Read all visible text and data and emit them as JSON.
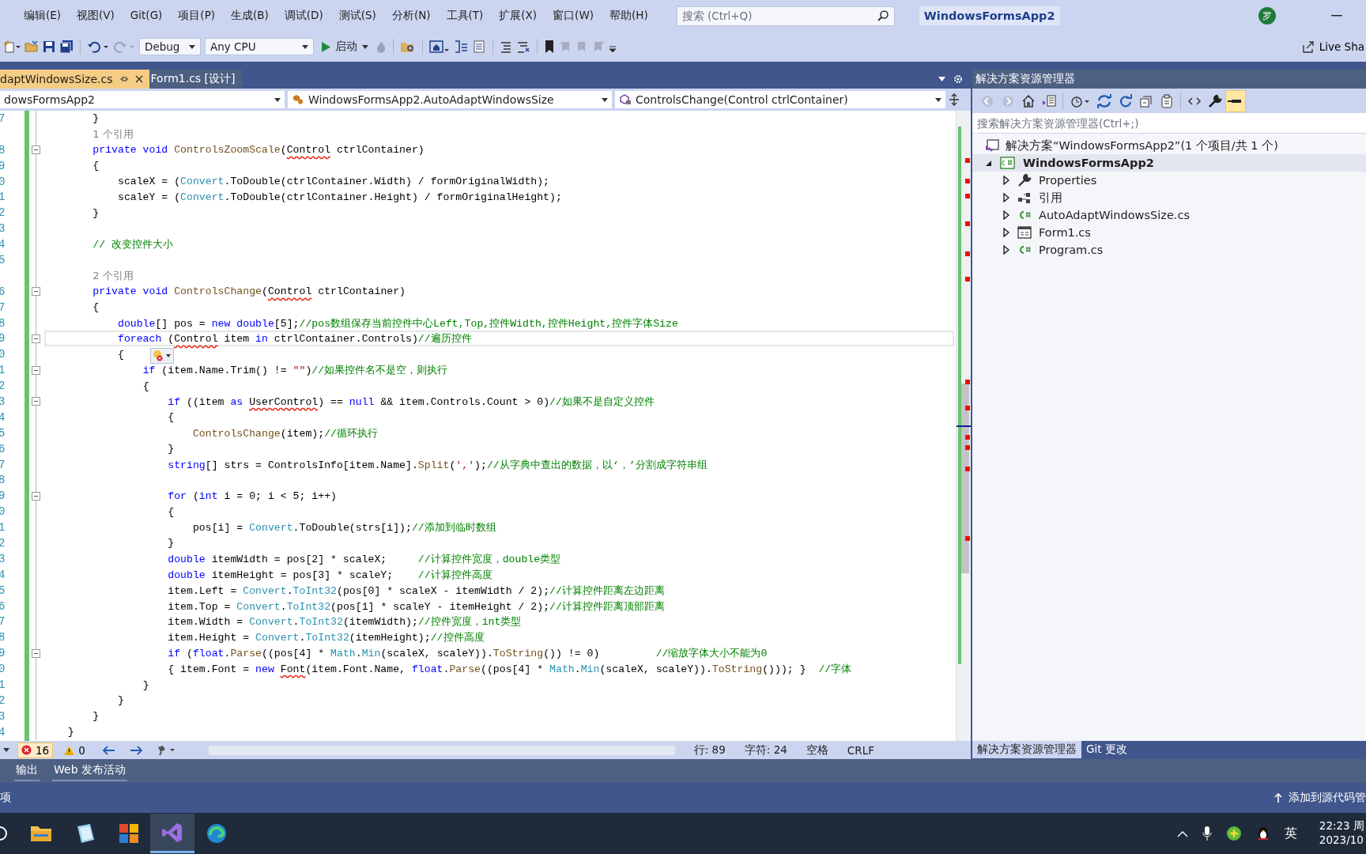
{
  "menu": [
    "编辑(E)",
    "视图(V)",
    "Git(G)",
    "项目(P)",
    "生成(B)",
    "调试(D)",
    "测试(S)",
    "分析(N)",
    "工具(T)",
    "扩展(X)",
    "窗口(W)",
    "帮助(H)"
  ],
  "search": {
    "placeholder": "搜索 (Ctrl+Q)"
  },
  "title": "WindowsFormsApp2",
  "account": {
    "initial": "罗"
  },
  "toolbar": {
    "configuration": "Debug",
    "platform": "Any CPU",
    "start": "启动",
    "live_share": "Live Sha"
  },
  "tabs": [
    {
      "label": "daptWindowsSize.cs",
      "selected": true
    },
    {
      "label": "Form1.cs [设计]",
      "selected": false
    }
  ],
  "nav": [
    "dowsFormsApp2",
    "WindowsFormsApp2.AutoAdaptWindowsSize",
    "ControlsChange(Control ctrlContainer)"
  ],
  "code": [
    {
      "kind": "code",
      "n": "7",
      "fold": false,
      "current": false,
      "tokens": [
        {
          "kind": "plain",
          "text": "        }"
        }
      ]
    },
    {
      "kind": "lens",
      "text": "        1 个引用"
    },
    {
      "kind": "code",
      "n": "8",
      "fold": true,
      "current": false,
      "tokens": [
        {
          "kind": "keyword",
          "text": "        private void"
        },
        {
          "kind": "method",
          "text": " ControlsZoomScale"
        },
        {
          "kind": "plain",
          "text": "("
        },
        {
          "kind": "error",
          "text": "Control"
        },
        {
          "kind": "plain",
          "text": " ctrlContainer)"
        }
      ]
    },
    {
      "kind": "code",
      "n": "9",
      "fold": false,
      "current": false,
      "tokens": [
        {
          "kind": "plain",
          "text": "        {"
        }
      ]
    },
    {
      "kind": "code",
      "n": "0",
      "fold": false,
      "current": false,
      "tokens": [
        {
          "kind": "plain",
          "text": "            scaleX = ("
        },
        {
          "kind": "type",
          "text": "Convert"
        },
        {
          "kind": "plain",
          "text": ".ToDouble(ctrlContainer.Width) / formOriginalWidth);"
        }
      ]
    },
    {
      "kind": "code",
      "n": "1",
      "fold": false,
      "current": false,
      "tokens": [
        {
          "kind": "plain",
          "text": "            scaleY = ("
        },
        {
          "kind": "type",
          "text": "Convert"
        },
        {
          "kind": "plain",
          "text": ".ToDouble(ctrlContainer.Height) / formOriginalHeight);"
        }
      ]
    },
    {
      "kind": "code",
      "n": "2",
      "fold": false,
      "current": false,
      "tokens": [
        {
          "kind": "plain",
          "text": "        }"
        }
      ]
    },
    {
      "kind": "code",
      "n": "3",
      "fold": false,
      "current": false
    },
    {
      "kind": "code",
      "n": "4",
      "fold": false,
      "current": false,
      "tokens": [
        {
          "kind": "comment",
          "text": "        // 改变控件大小"
        }
      ]
    },
    {
      "kind": "code",
      "n": "5",
      "fold": false,
      "current": false
    },
    {
      "kind": "lens",
      "text": "        2 个引用"
    },
    {
      "kind": "code",
      "n": "6",
      "fold": true,
      "current": false,
      "tokens": [
        {
          "kind": "keyword",
          "text": "        private void"
        },
        {
          "kind": "method",
          "text": " ControlsChange"
        },
        {
          "kind": "plain",
          "text": "("
        },
        {
          "kind": "error",
          "text": "Control"
        },
        {
          "kind": "plain",
          "text": " ctrlContainer)"
        }
      ]
    },
    {
      "kind": "code",
      "n": "7",
      "fold": false,
      "current": false,
      "tokens": [
        {
          "kind": "plain",
          "text": "        {"
        }
      ]
    },
    {
      "kind": "code",
      "n": "8",
      "fold": false,
      "current": false,
      "tokens": [
        {
          "kind": "keyword",
          "text": "            double"
        },
        {
          "kind": "plain",
          "text": "[] pos = "
        },
        {
          "kind": "keyword",
          "text": "new double"
        },
        {
          "kind": "plain",
          "text": "[5];"
        },
        {
          "kind": "comment",
          "text": "//pos数组保存当前控件中心Left,Top,控件Width,控件Height,控件字体Size"
        }
      ]
    },
    {
      "kind": "code",
      "n": "9",
      "fold": true,
      "current": true,
      "tokens": [
        {
          "kind": "keyword",
          "text": "            foreach"
        },
        {
          "kind": "plain",
          "text": " ("
        },
        {
          "kind": "error",
          "text": "Control"
        },
        {
          "kind": "plain",
          "text": " item "
        },
        {
          "kind": "keyword",
          "text": "in"
        },
        {
          "kind": "plain",
          "text": " ctrlContainer.Controls)"
        },
        {
          "kind": "comment",
          "text": "//遍历控件"
        }
      ]
    },
    {
      "kind": "code",
      "n": "0",
      "fold": false,
      "current": false,
      "tokens": [
        {
          "kind": "plain",
          "text": "            {"
        }
      ]
    },
    {
      "kind": "code",
      "n": "1",
      "fold": true,
      "current": false,
      "tokens": [
        {
          "kind": "keyword",
          "text": "                if"
        },
        {
          "kind": "plain",
          "text": " (item.Name.Trim() != "
        },
        {
          "kind": "string",
          "text": "\"\""
        },
        {
          "kind": "plain",
          "text": ")"
        },
        {
          "kind": "comment",
          "text": "//如果控件名不是空，则执行"
        }
      ]
    },
    {
      "kind": "code",
      "n": "2",
      "fold": false,
      "current": false,
      "tokens": [
        {
          "kind": "plain",
          "text": "                {"
        }
      ]
    },
    {
      "kind": "code",
      "n": "3",
      "fold": true,
      "current": false,
      "tokens": [
        {
          "kind": "keyword",
          "text": "                    if"
        },
        {
          "kind": "plain",
          "text": " ((item "
        },
        {
          "kind": "keyword",
          "text": "as "
        },
        {
          "kind": "error",
          "text": "UserControl"
        },
        {
          "kind": "plain",
          "text": ") == "
        },
        {
          "kind": "keyword",
          "text": "null"
        },
        {
          "kind": "plain",
          "text": " && item.Controls.Count > 0)"
        },
        {
          "kind": "comment",
          "text": "//如果不是自定义控件"
        }
      ]
    },
    {
      "kind": "code",
      "n": "4",
      "fold": false,
      "current": false,
      "tokens": [
        {
          "kind": "plain",
          "text": "                    {"
        }
      ]
    },
    {
      "kind": "code",
      "n": "5",
      "fold": false,
      "current": false,
      "tokens": [
        {
          "kind": "method",
          "text": "                        ControlsChange"
        },
        {
          "kind": "plain",
          "text": "(item);"
        },
        {
          "kind": "comment",
          "text": "//循环执行"
        }
      ]
    },
    {
      "kind": "code",
      "n": "6",
      "fold": false,
      "current": false,
      "tokens": [
        {
          "kind": "plain",
          "text": "                    }"
        }
      ]
    },
    {
      "kind": "code",
      "n": "7",
      "fold": false,
      "current": false,
      "tokens": [
        {
          "kind": "keyword",
          "text": "                    string"
        },
        {
          "kind": "plain",
          "text": "[] strs = ControlsInfo[item.Name]."
        },
        {
          "kind": "method",
          "text": "Split"
        },
        {
          "kind": "plain",
          "text": "("
        },
        {
          "kind": "string",
          "text": "','"
        },
        {
          "kind": "plain",
          "text": ");"
        },
        {
          "kind": "comment",
          "text": "//从字典中查出的数据，以‘，’分割成字符串组"
        }
      ]
    },
    {
      "kind": "code",
      "n": "8",
      "fold": false,
      "current": false
    },
    {
      "kind": "code",
      "n": "9",
      "fold": true,
      "current": false,
      "tokens": [
        {
          "kind": "keyword",
          "text": "                    for"
        },
        {
          "kind": "plain",
          "text": " ("
        },
        {
          "kind": "keyword",
          "text": "int"
        },
        {
          "kind": "plain",
          "text": " i = 0; i < 5; i++)"
        }
      ]
    },
    {
      "kind": "code",
      "n": "0",
      "fold": false,
      "current": false,
      "tokens": [
        {
          "kind": "plain",
          "text": "                    {"
        }
      ]
    },
    {
      "kind": "code",
      "n": "1",
      "fold": false,
      "current": false,
      "tokens": [
        {
          "kind": "plain",
          "text": "                        pos[i] = "
        },
        {
          "kind": "type",
          "text": "Convert"
        },
        {
          "kind": "plain",
          "text": ".ToDouble(strs[i]);"
        },
        {
          "kind": "comment",
          "text": "//添加到临时数组"
        }
      ]
    },
    {
      "kind": "code",
      "n": "2",
      "fold": false,
      "current": false,
      "tokens": [
        {
          "kind": "plain",
          "text": "                    }"
        }
      ]
    },
    {
      "kind": "code",
      "n": "3",
      "fold": false,
      "current": false,
      "tokens": [
        {
          "kind": "keyword",
          "text": "                    double"
        },
        {
          "kind": "plain",
          "text": " itemWidth = pos[2] * scaleX;     "
        },
        {
          "kind": "comment",
          "text": "//计算控件宽度，double类型"
        }
      ]
    },
    {
      "kind": "code",
      "n": "4",
      "fold": false,
      "current": false,
      "tokens": [
        {
          "kind": "keyword",
          "text": "                    double"
        },
        {
          "kind": "plain",
          "text": " itemHeight = pos[3] * scaleY;    "
        },
        {
          "kind": "comment",
          "text": "//计算控件高度"
        }
      ]
    },
    {
      "kind": "code",
      "n": "5",
      "fold": false,
      "current": false,
      "tokens": [
        {
          "kind": "plain",
          "text": "                    item.Left = "
        },
        {
          "kind": "type",
          "text": "Convert"
        },
        {
          "kind": "plain",
          "text": "."
        },
        {
          "kind": "type",
          "text": "ToInt32"
        },
        {
          "kind": "plain",
          "text": "(pos[0] * scaleX - itemWidth / 2);"
        },
        {
          "kind": "comment",
          "text": "//计算控件距离左边距离"
        }
      ]
    },
    {
      "kind": "code",
      "n": "6",
      "fold": false,
      "current": false,
      "tokens": [
        {
          "kind": "plain",
          "text": "                    item.Top = "
        },
        {
          "kind": "type",
          "text": "Convert"
        },
        {
          "kind": "plain",
          "text": "."
        },
        {
          "kind": "type",
          "text": "ToInt32"
        },
        {
          "kind": "plain",
          "text": "(pos[1] * scaleY - itemHeight / 2);"
        },
        {
          "kind": "comment",
          "text": "//计算控件距离顶部距离"
        }
      ]
    },
    {
      "kind": "code",
      "n": "7",
      "fold": false,
      "current": false,
      "tokens": [
        {
          "kind": "plain",
          "text": "                    item.Width = "
        },
        {
          "kind": "type",
          "text": "Convert"
        },
        {
          "kind": "plain",
          "text": "."
        },
        {
          "kind": "type",
          "text": "ToInt32"
        },
        {
          "kind": "plain",
          "text": "(itemWidth);"
        },
        {
          "kind": "comment",
          "text": "//控件宽度，int类型"
        }
      ]
    },
    {
      "kind": "code",
      "n": "8",
      "fold": false,
      "current": false,
      "tokens": [
        {
          "kind": "plain",
          "text": "                    item.Height = "
        },
        {
          "kind": "type",
          "text": "Convert"
        },
        {
          "kind": "plain",
          "text": "."
        },
        {
          "kind": "type",
          "text": "ToInt32"
        },
        {
          "kind": "plain",
          "text": "(itemHeight);"
        },
        {
          "kind": "comment",
          "text": "//控件高度"
        }
      ]
    },
    {
      "kind": "code",
      "n": "9",
      "fold": true,
      "current": false,
      "tokens": [
        {
          "kind": "keyword",
          "text": "                    if"
        },
        {
          "kind": "plain",
          "text": " ("
        },
        {
          "kind": "keyword",
          "text": "float"
        },
        {
          "kind": "plain",
          "text": "."
        },
        {
          "kind": "method",
          "text": "Parse"
        },
        {
          "kind": "plain",
          "text": "((pos[4] * "
        },
        {
          "kind": "type",
          "text": "Math"
        },
        {
          "kind": "plain",
          "text": "."
        },
        {
          "kind": "type",
          "text": "Min"
        },
        {
          "kind": "plain",
          "text": "(scaleX, scaleY))."
        },
        {
          "kind": "method",
          "text": "ToString"
        },
        {
          "kind": "plain",
          "text": "()) != 0)         "
        },
        {
          "kind": "comment",
          "text": "//缩放字体大小不能为0"
        }
      ]
    },
    {
      "kind": "code",
      "n": "0",
      "fold": false,
      "current": false,
      "tokens": [
        {
          "kind": "plain",
          "text": "                    { item.Font = "
        },
        {
          "kind": "keyword",
          "text": "new "
        },
        {
          "kind": "error",
          "text": "Font"
        },
        {
          "kind": "plain",
          "text": "(item.Font.Name, "
        },
        {
          "kind": "keyword",
          "text": "float"
        },
        {
          "kind": "plain",
          "text": "."
        },
        {
          "kind": "method",
          "text": "Parse"
        },
        {
          "kind": "plain",
          "text": "((pos[4] * "
        },
        {
          "kind": "type",
          "text": "Math"
        },
        {
          "kind": "plain",
          "text": "."
        },
        {
          "kind": "type",
          "text": "Min"
        },
        {
          "kind": "plain",
          "text": "(scaleX, scaleY))."
        },
        {
          "kind": "method",
          "text": "ToString"
        },
        {
          "kind": "plain",
          "text": "())); }  "
        },
        {
          "kind": "comment",
          "text": "//字体"
        }
      ]
    },
    {
      "kind": "code",
      "n": "1",
      "fold": false,
      "current": false,
      "tokens": [
        {
          "kind": "plain",
          "text": "                }"
        }
      ]
    },
    {
      "kind": "code",
      "n": "2",
      "fold": false,
      "current": false,
      "tokens": [
        {
          "kind": "plain",
          "text": "            }"
        }
      ]
    },
    {
      "kind": "code",
      "n": "3",
      "fold": false,
      "current": false,
      "tokens": [
        {
          "kind": "plain",
          "text": "        }"
        }
      ]
    },
    {
      "kind": "code",
      "n": "4",
      "fold": false,
      "current": false,
      "tokens": [
        {
          "kind": "plain",
          "text": "    }"
        }
      ]
    }
  ],
  "editor_status": {
    "errors": "16",
    "warnings": "0",
    "line": "行: 89",
    "column": "字符: 24",
    "spacing": "空格",
    "eol": "CRLF"
  },
  "explorer": {
    "title": "解决方案资源管理器",
    "search": {
      "placeholder": "搜索解决方案资源管理器(Ctrl+;)"
    },
    "solution": {
      "label": "解决方案“WindowsFormsApp2”(1 个项目/共 1 个)",
      "children": [
        {
          "label": "WindowsFormsApp2",
          "kind": "project",
          "expanded": true,
          "selected": true,
          "children": [
            {
              "label": "Properties",
              "kind": "properties",
              "expanded": false,
              "selected": false
            },
            {
              "label": "引用",
              "kind": "references",
              "expanded": false,
              "selected": false
            },
            {
              "label": "AutoAdaptWindowsSize.cs",
              "kind": "csharp",
              "expanded": false,
              "selected": false
            },
            {
              "label": "Form1.cs",
              "kind": "form",
              "expanded": false,
              "selected": false
            },
            {
              "label": "Program.cs",
              "kind": "csharp",
              "expanded": false,
              "selected": false
            }
          ]
        }
      ]
    },
    "tabs": [
      {
        "label": "解决方案资源管理器",
        "selected": true
      },
      {
        "label": "Git 更改",
        "selected": false
      }
    ]
  },
  "tool_tabs": [
    "输出",
    "Web 发布活动"
  ],
  "status_bar": {
    "left": "项",
    "right": "添加到源代码管"
  },
  "taskbar": {
    "ime": "英",
    "time": "22:23 周",
    "date": "2023/10"
  }
}
